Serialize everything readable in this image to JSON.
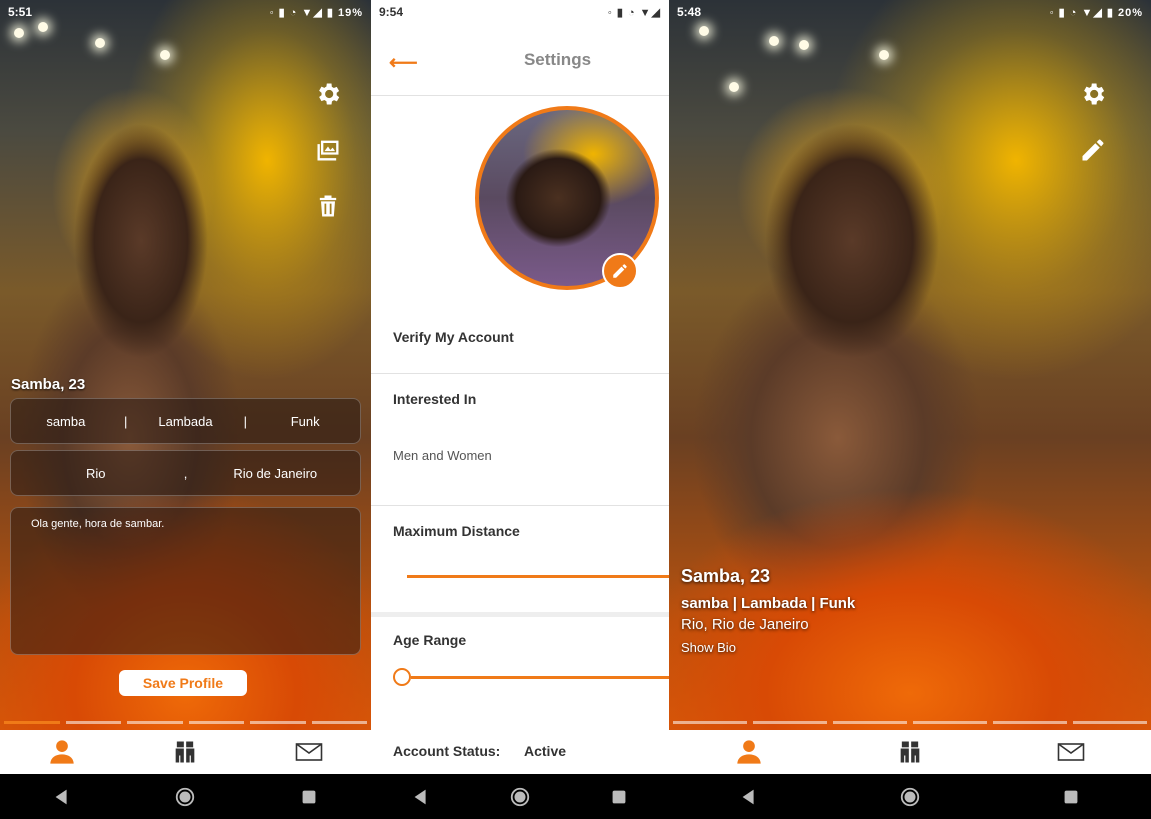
{
  "colors": {
    "accent": "#f07a18",
    "navbar": "#000000",
    "tab_inactive": "#333333"
  },
  "panel1": {
    "status": {
      "time": "5:51",
      "battery": "19%"
    },
    "name_age": "Samba, 23",
    "tags": [
      "samba",
      "Lambada",
      "Funk"
    ],
    "tag_separator": "|",
    "city": "Rio",
    "city_separator": ",",
    "state": "Rio de Janeiro",
    "bio": "Ola gente, hora de sambar.",
    "save_label": "Save Profile",
    "photo_count": 6,
    "active_photo_index": 1
  },
  "panel2": {
    "status": {
      "time": "9:54"
    },
    "title": "Settings",
    "verify_label": "Verify My Account",
    "interested_label": "Interested In",
    "interested_value": "Men and Women",
    "distance_label": "Maximum Distance",
    "age_label": "Age Range",
    "account_status_label": "Account Status:",
    "account_status_value": "Active"
  },
  "panel3": {
    "status": {
      "time": "5:48",
      "battery": "20%"
    },
    "name_age": "Samba, 23",
    "tags_line": "samba | Lambada | Funk",
    "location_line": "Rio, Rio de Janeiro",
    "show_bio_label": "Show Bio",
    "photo_count": 6
  },
  "icons": {
    "settings": "gear-icon",
    "gallery": "image-gallery-icon",
    "delete": "trash-icon",
    "edit": "pencil-icon",
    "profile_tab": "person-icon",
    "matches_tab": "couple-icon",
    "messages_tab": "envelope-icon",
    "back": "back-arrow-icon",
    "nav_back": "triangle-back-icon",
    "nav_home": "circle-home-icon",
    "nav_recent": "square-recent-icon"
  }
}
